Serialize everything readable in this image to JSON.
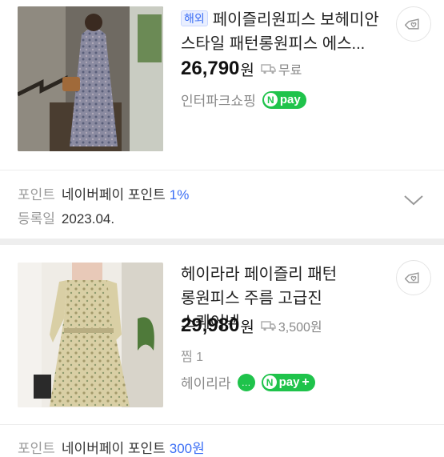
{
  "products": [
    {
      "badge": "해외",
      "title": "페이즐리원피스 보헤미안 스타일 패턴롱원피스 에스...",
      "price": "26,790",
      "currency": "원",
      "shipping": "무료",
      "store": "인터파크쇼핑",
      "pay_label": "pay",
      "pay_n": "N"
    },
    {
      "title": "헤이라라 페이즐리 패턴 롱원피스 주름 고급진 스퀘어넥",
      "price": "29,980",
      "currency": "원",
      "shipping": "3,500원",
      "likes": "찜 1",
      "store": "헤이리라",
      "pay_label": "pay",
      "pay_n": "N",
      "pay_plus": "+",
      "talk_icon": "…"
    }
  ],
  "info": {
    "point_key": "포인트",
    "point_value": "네이버페이 포인트",
    "point_pct": "1%",
    "date_key": "등록일",
    "date_value": "2023.04."
  },
  "footer_partial": {
    "point_key": "포인트",
    "point_value": "네이버페이 포인트",
    "point_pct": "300원"
  },
  "colors": {
    "accent": "#3b6ef5",
    "npay": "#1fc34b",
    "divider": "#eeeeee"
  },
  "icons": [
    "heart-tag-icon",
    "truck-icon",
    "chevron-down-icon",
    "talk-icon"
  ]
}
